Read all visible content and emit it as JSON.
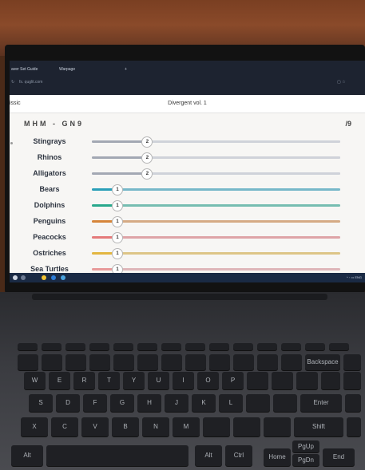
{
  "browser": {
    "tab1_label": "aver Set Guide",
    "tab2_label": "Warpage",
    "address": "fs. quglit.com"
  },
  "app": {
    "left_label": "issic",
    "title": "Divergent vol. 1"
  },
  "set": {
    "code": "MHM - GN9",
    "total": "/9"
  },
  "rows": [
    {
      "label": "Stingrays",
      "count": "2",
      "level": 0.22,
      "color": "#a3a8b3"
    },
    {
      "label": "Rhinos",
      "count": "2",
      "level": 0.22,
      "color": "#a3a8b3"
    },
    {
      "label": "Alligators",
      "count": "2",
      "level": 0.22,
      "color": "#a3a8b3"
    },
    {
      "label": "Bears",
      "count": "1",
      "level": 0.1,
      "color": "#2a9fb8"
    },
    {
      "label": "Dolphins",
      "count": "1",
      "level": 0.1,
      "color": "#28a88c"
    },
    {
      "label": "Penguins",
      "count": "1",
      "level": 0.1,
      "color": "#d6853a"
    },
    {
      "label": "Peacocks",
      "count": "1",
      "level": 0.1,
      "color": "#e57a7a"
    },
    {
      "label": "Ostriches",
      "count": "1",
      "level": 0.1,
      "color": "#e3b640"
    },
    {
      "label": "Sea Turtles",
      "count": "1",
      "level": 0.1,
      "color": "#e89a9a"
    }
  ],
  "keyboard": {
    "backspace": "Backspace",
    "enter": "Enter",
    "shift": "Shift",
    "alt": "Alt",
    "ctrl": "Ctrl",
    "home": "Home",
    "pgup": "PgUp",
    "pgdn": "PgDn",
    "end": "End",
    "row_qwerty": [
      "W",
      "E",
      "R",
      "T",
      "Y",
      "U",
      "I",
      "O",
      "P"
    ],
    "row_asdf": [
      "S",
      "D",
      "F",
      "G",
      "H",
      "J",
      "K",
      "L"
    ],
    "row_zxcv": [
      "X",
      "C",
      "V",
      "B",
      "N",
      "M"
    ]
  },
  "colors": {
    "screen_bg": "#f7f6f4",
    "browser_bar": "#1d2330",
    "taskbar": "#1a2a44"
  }
}
